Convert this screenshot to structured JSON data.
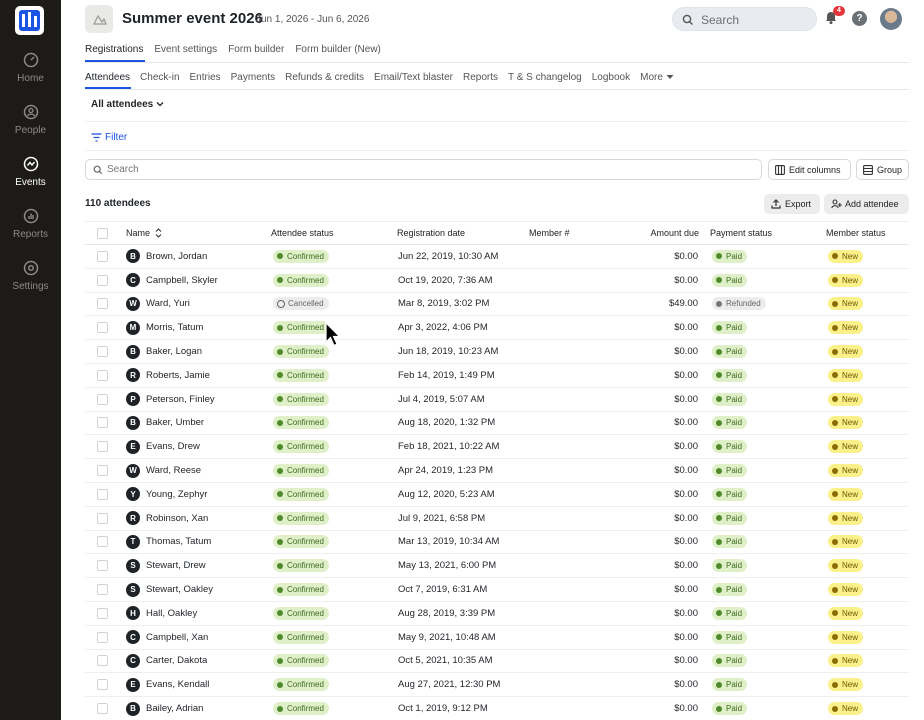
{
  "sidebar": {
    "items": [
      {
        "label": "Home",
        "icon": "gauge-icon"
      },
      {
        "label": "People",
        "icon": "person-icon"
      },
      {
        "label": "Events",
        "icon": "events-icon"
      },
      {
        "label": "Reports",
        "icon": "bar-chart-icon"
      },
      {
        "label": "Settings",
        "icon": "gear-icon"
      }
    ],
    "active": "Events"
  },
  "header": {
    "title": "Summer event 2026",
    "dates": "Jun 1, 2026 - Jun 6, 2026",
    "search_placeholder": "Search",
    "notification_count": "4",
    "help": "?"
  },
  "tabs_primary": [
    {
      "label": "Registrations"
    },
    {
      "label": "Event settings"
    },
    {
      "label": "Form builder"
    },
    {
      "label": "Form builder (New)"
    }
  ],
  "tabs_secondary": [
    {
      "label": "Attendees"
    },
    {
      "label": "Check-in"
    },
    {
      "label": "Entries"
    },
    {
      "label": "Payments"
    },
    {
      "label": "Refunds & credits"
    },
    {
      "label": "Email/Text blaster"
    },
    {
      "label": "Reports"
    },
    {
      "label": "T & S changelog"
    },
    {
      "label": "Logbook"
    },
    {
      "label": "More"
    }
  ],
  "view_selector": "All attendees",
  "filter_label": "Filter",
  "search_placeholder": "Search",
  "edit_columns_label": "Edit columns",
  "group_label": "Group",
  "attendee_count": "110 attendees",
  "export_label": "Export",
  "add_attendee_label": "Add attendee",
  "columns": {
    "name": "Name",
    "attendee_status": "Attendee status",
    "registration_date": "Registration date",
    "member_num": "Member #",
    "amount_due": "Amount due",
    "payment_status": "Payment status",
    "member_status": "Member status"
  },
  "colors": {
    "accent": "#1a55e3",
    "sidebar_bg": "#1c1b18",
    "confirmed_bg": "#dff0c8",
    "new_bg": "#fbf08a",
    "badge": "#e5363c"
  },
  "rows": [
    {
      "initial": "B",
      "name": "Brown, Jordan",
      "status": "Confirmed",
      "date": "Jun 22, 2019, 10:30 AM",
      "member": "",
      "amount": "$0.00",
      "payment": "Paid",
      "member_status": "New"
    },
    {
      "initial": "C",
      "name": "Campbell, Skyler",
      "status": "Confirmed",
      "date": "Oct 19, 2020, 7:36 AM",
      "member": "",
      "amount": "$0.00",
      "payment": "Paid",
      "member_status": "New"
    },
    {
      "initial": "W",
      "name": "Ward, Yuri",
      "status": "Cancelled",
      "date": "Mar 8, 2019, 3:02 PM",
      "member": "",
      "amount": "$49.00",
      "payment": "Refunded",
      "member_status": "New"
    },
    {
      "initial": "M",
      "name": "Morris, Tatum",
      "status": "Confirmed",
      "date": "Apr 3, 2022, 4:06 PM",
      "member": "",
      "amount": "$0.00",
      "payment": "Paid",
      "member_status": "New"
    },
    {
      "initial": "B",
      "name": "Baker, Logan",
      "status": "Confirmed",
      "date": "Jun 18, 2019, 10:23 AM",
      "member": "",
      "amount": "$0.00",
      "payment": "Paid",
      "member_status": "New"
    },
    {
      "initial": "R",
      "name": "Roberts, Jamie",
      "status": "Confirmed",
      "date": "Feb 14, 2019, 1:49 PM",
      "member": "",
      "amount": "$0.00",
      "payment": "Paid",
      "member_status": "New"
    },
    {
      "initial": "P",
      "name": "Peterson, Finley",
      "status": "Confirmed",
      "date": "Jul 4, 2019, 5:07 AM",
      "member": "",
      "amount": "$0.00",
      "payment": "Paid",
      "member_status": "New"
    },
    {
      "initial": "B",
      "name": "Baker, Umber",
      "status": "Confirmed",
      "date": "Aug 18, 2020, 1:32 PM",
      "member": "",
      "amount": "$0.00",
      "payment": "Paid",
      "member_status": "New"
    },
    {
      "initial": "E",
      "name": "Evans, Drew",
      "status": "Confirmed",
      "date": "Feb 18, 2021, 10:22 AM",
      "member": "",
      "amount": "$0.00",
      "payment": "Paid",
      "member_status": "New"
    },
    {
      "initial": "W",
      "name": "Ward, Reese",
      "status": "Confirmed",
      "date": "Apr 24, 2019, 1:23 PM",
      "member": "",
      "amount": "$0.00",
      "payment": "Paid",
      "member_status": "New"
    },
    {
      "initial": "Y",
      "name": "Young, Zephyr",
      "status": "Confirmed",
      "date": "Aug 12, 2020, 5:23 AM",
      "member": "",
      "amount": "$0.00",
      "payment": "Paid",
      "member_status": "New"
    },
    {
      "initial": "R",
      "name": "Robinson, Xan",
      "status": "Confirmed",
      "date": "Jul 9, 2021, 6:58 PM",
      "member": "",
      "amount": "$0.00",
      "payment": "Paid",
      "member_status": "New"
    },
    {
      "initial": "T",
      "name": "Thomas, Tatum",
      "status": "Confirmed",
      "date": "Mar 13, 2019, 10:34 AM",
      "member": "",
      "amount": "$0.00",
      "payment": "Paid",
      "member_status": "New"
    },
    {
      "initial": "S",
      "name": "Stewart, Drew",
      "status": "Confirmed",
      "date": "May 13, 2021, 6:00 PM",
      "member": "",
      "amount": "$0.00",
      "payment": "Paid",
      "member_status": "New"
    },
    {
      "initial": "S",
      "name": "Stewart, Oakley",
      "status": "Confirmed",
      "date": "Oct 7, 2019, 6:31 AM",
      "member": "",
      "amount": "$0.00",
      "payment": "Paid",
      "member_status": "New"
    },
    {
      "initial": "H",
      "name": "Hall, Oakley",
      "status": "Confirmed",
      "date": "Aug 28, 2019, 3:39 PM",
      "member": "",
      "amount": "$0.00",
      "payment": "Paid",
      "member_status": "New"
    },
    {
      "initial": "C",
      "name": "Campbell, Xan",
      "status": "Confirmed",
      "date": "May 9, 2021, 10:48 AM",
      "member": "",
      "amount": "$0.00",
      "payment": "Paid",
      "member_status": "New"
    },
    {
      "initial": "C",
      "name": "Carter, Dakota",
      "status": "Confirmed",
      "date": "Oct 5, 2021, 10:35 AM",
      "member": "",
      "amount": "$0.00",
      "payment": "Paid",
      "member_status": "New"
    },
    {
      "initial": "E",
      "name": "Evans, Kendall",
      "status": "Confirmed",
      "date": "Aug 27, 2021, 12:30 PM",
      "member": "",
      "amount": "$0.00",
      "payment": "Paid",
      "member_status": "New"
    },
    {
      "initial": "B",
      "name": "Bailey, Adrian",
      "status": "Confirmed",
      "date": "Oct 1, 2019, 9:12 PM",
      "member": "",
      "amount": "$0.00",
      "payment": "Paid",
      "member_status": "New"
    }
  ]
}
